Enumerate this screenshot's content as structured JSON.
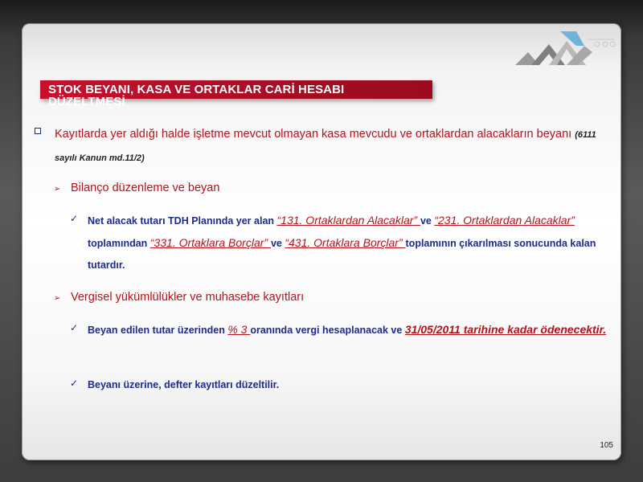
{
  "slide": {
    "title_line1": "STOK BEYANI, KASA VE ORTAKLAR CARİ HESABI",
    "title_line2": "DÜZELTMESİ",
    "page_number": "105",
    "colors": {
      "accent_red": "#b5121b",
      "title_bg": "#c8102e",
      "text_blue": "#1e2b8a"
    }
  },
  "content": {
    "level1": {
      "text": "Kayıtlarda yer aldığı halde işletme mevcut olmayan kasa mevcudu ve ortaklardan alacakların beyanı",
      "ref": "(6111 sayılı Kanun md.11/2)"
    },
    "sections": [
      {
        "heading": "Bilanço düzenleme ve beyan",
        "items": [
          {
            "p1": "Net alacak tutarı TDH Planında yer alan ",
            "h1": "“131. Ortaklardan Alacaklar” ",
            "p2": "ve ",
            "h2": "“231. Ortaklardan Alacaklar” ",
            "p3": "toplamından ",
            "h3": "“331. Ortaklara Borçlar” ",
            "p4": "ve ",
            "h4": "“431. Ortaklara Borçlar” ",
            "p5": "toplamının çıkarılması sonucunda kalan tutardır."
          }
        ]
      },
      {
        "heading": "Vergisel yükümlülükler ve muhasebe kayıtları",
        "items": [
          {
            "p1": "Beyan edilen tutar üzerinden ",
            "h1": "% 3 ",
            "p2": "oranında vergi hesaplanacak ve ",
            "h2": "31/05/2011 tarihine kadar ödenecektir."
          },
          {
            "p1": "Beyanı üzerine, defter kayıtları düzeltilir."
          }
        ]
      }
    ]
  },
  "icons": {
    "bullet": "square-bullet-icon",
    "arrow": "arrow-bullet-icon",
    "check": "checkmark-icon",
    "logo": "company-logo"
  }
}
